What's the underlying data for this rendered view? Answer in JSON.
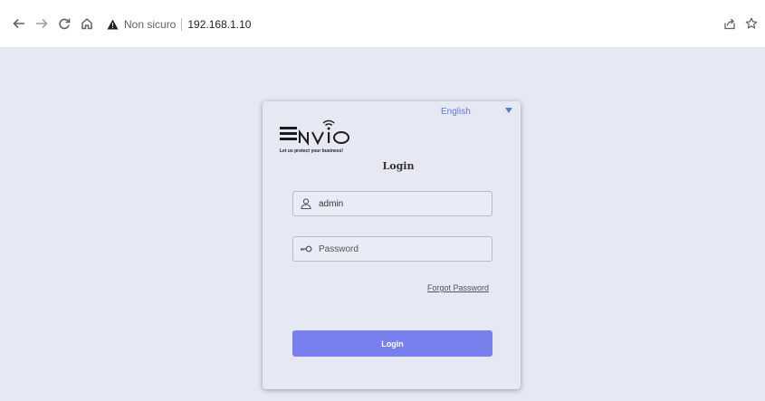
{
  "browser": {
    "security_label": "Non sicuro",
    "url": "192.168.1.10",
    "icons": [
      "back-icon",
      "forward-icon",
      "reload-icon",
      "home-icon",
      "warning-icon",
      "share-icon",
      "bookmark-star-icon"
    ]
  },
  "login": {
    "language": "English",
    "brand_tagline": "Let us protect your business!",
    "title": "Login",
    "username_value": "admin",
    "password_placeholder": "Password",
    "forgot_label": "Forgot Password",
    "submit_label": "Login",
    "accent_color": "#7a7ff0",
    "link_color": "#5b7bd5"
  }
}
